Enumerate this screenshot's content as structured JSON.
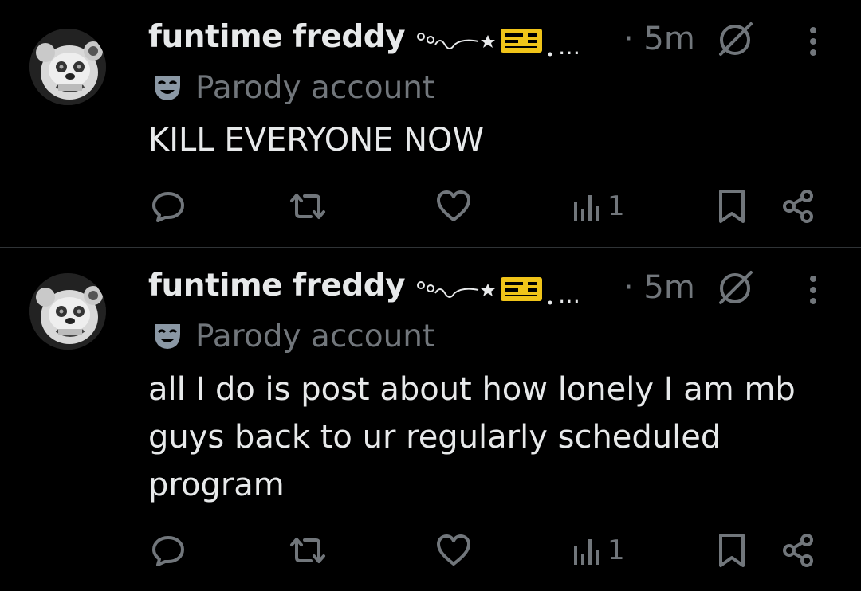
{
  "posts": [
    {
      "author_name": "funtime freddy",
      "name_suffix": "…",
      "time": "· 5m",
      "parody_label": "Parody account",
      "text": "KILL EVERYONE NOW",
      "views": "1"
    },
    {
      "author_name": "funtime freddy",
      "name_suffix": "…",
      "time": "· 5m",
      "parody_label": "Parody account",
      "text": "all I do is post about how lonely I am mb guys back to ur regularly scheduled program",
      "views": "1"
    }
  ],
  "icons": {
    "reply": "reply-icon",
    "repost": "repost-icon",
    "like": "heart-icon",
    "views": "views-icon",
    "bookmark": "bookmark-icon",
    "share": "share-icon",
    "grok": "grok-icon",
    "more": "more-icon",
    "parody": "mask-icon"
  },
  "colors": {
    "background": "#000000",
    "primary_text": "#e7e9ea",
    "secondary_text": "#71767b",
    "divider": "#2f3336",
    "ticket": "#f0c419"
  }
}
